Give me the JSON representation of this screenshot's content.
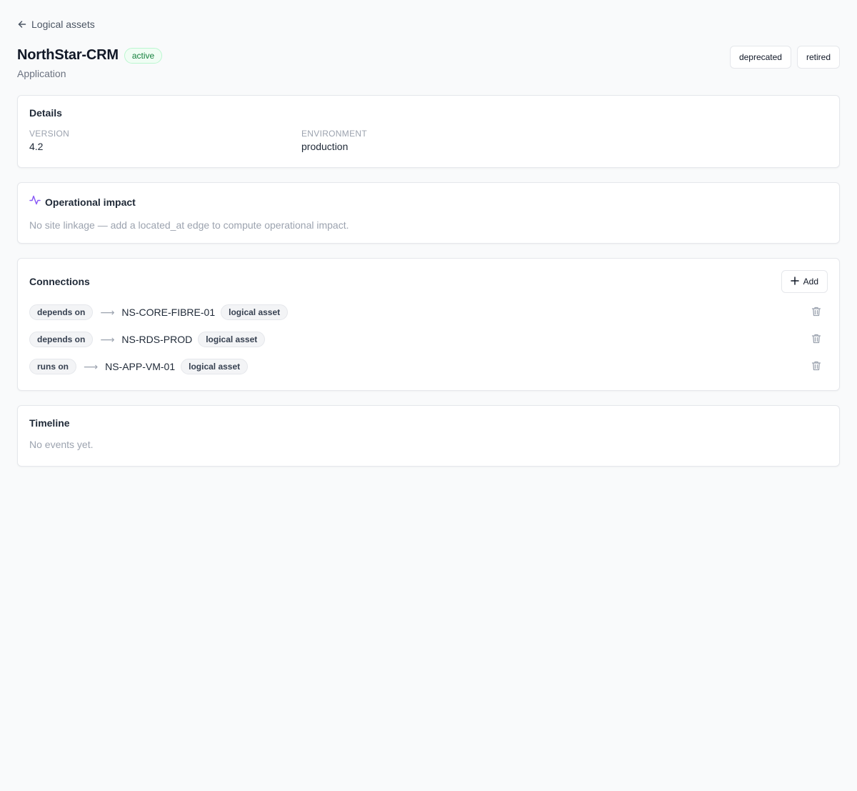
{
  "nav": {
    "back_label": "Logical assets"
  },
  "asset": {
    "name": "NorthStar-CRM",
    "status": "active",
    "type": "Application"
  },
  "actions": {
    "deprecated_label": "deprecated",
    "retired_label": "retired"
  },
  "details": {
    "title": "Details",
    "fields": [
      {
        "label": "VERSION",
        "value": "4.2"
      },
      {
        "label": "ENVIRONMENT",
        "value": "production"
      }
    ]
  },
  "impact": {
    "title": "Operational impact",
    "message": "No site linkage — add a located_at edge to compute operational impact."
  },
  "connections": {
    "title": "Connections",
    "add_label": "Add",
    "items": [
      {
        "relation": "depends on",
        "target": "NS-CORE-FIBRE-01",
        "kind": "logical asset"
      },
      {
        "relation": "depends on",
        "target": "NS-RDS-PROD",
        "kind": "logical asset"
      },
      {
        "relation": "runs on",
        "target": "NS-APP-VM-01",
        "kind": "logical asset"
      }
    ]
  },
  "timeline": {
    "title": "Timeline",
    "empty": "No events yet."
  },
  "colors": {
    "accent_purple": "#8b5cf6",
    "status_green": "#15803d",
    "status_green_bg": "#f0fdf4"
  },
  "icons": [
    "arrow-left-icon",
    "activity-icon",
    "plus-icon",
    "trash-icon",
    "arrow-right-icon"
  ]
}
